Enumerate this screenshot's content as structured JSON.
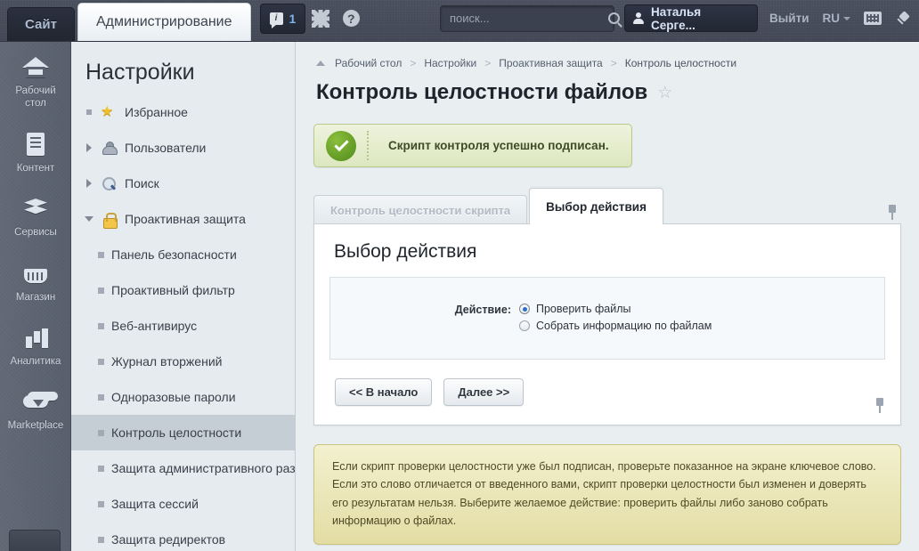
{
  "header": {
    "site_tab": "Сайт",
    "admin_tab": "Администрирование",
    "notifications_count": "1",
    "gear_icon": "gear-icon",
    "help_icon": "help-icon",
    "search_placeholder": "поиск...",
    "search_value": "",
    "user_name": "Наталья Серге...",
    "logout": "Выйти",
    "language": "RU",
    "keyboard_icon": "keyboard-icon",
    "pin_icon": "pin-icon"
  },
  "rail": {
    "items": [
      {
        "label": "Рабочий стол",
        "icon": "home-icon"
      },
      {
        "label": "Контент",
        "icon": "document-icon"
      },
      {
        "label": "Сервисы",
        "icon": "layers-icon"
      },
      {
        "label": "Магазин",
        "icon": "basket-icon"
      },
      {
        "label": "Аналитика",
        "icon": "bar-chart-icon"
      },
      {
        "label": "Marketplace",
        "icon": "cloud-download-icon"
      }
    ]
  },
  "nav": {
    "title": "Настройки",
    "items": [
      {
        "label": "Избранное",
        "twisty": "square",
        "icon": "star-icon",
        "selected": false,
        "sub": false
      },
      {
        "label": "Пользователи",
        "twisty": "right",
        "icon": "user-icon",
        "selected": false,
        "sub": false
      },
      {
        "label": "Поиск",
        "twisty": "right",
        "icon": "search-icon",
        "selected": false,
        "sub": false
      },
      {
        "label": "Проактивная защита",
        "twisty": "down",
        "icon": "lock-icon",
        "selected": false,
        "sub": false
      },
      {
        "label": "Панель безопасности",
        "twisty": "dot",
        "icon": "",
        "selected": false,
        "sub": true
      },
      {
        "label": "Проактивный фильтр",
        "twisty": "dot",
        "icon": "",
        "selected": false,
        "sub": true
      },
      {
        "label": "Веб-антивирус",
        "twisty": "dot",
        "icon": "",
        "selected": false,
        "sub": true
      },
      {
        "label": "Журнал вторжений",
        "twisty": "dot",
        "icon": "",
        "selected": false,
        "sub": true
      },
      {
        "label": "Одноразовые пароли",
        "twisty": "dot",
        "icon": "",
        "selected": false,
        "sub": true
      },
      {
        "label": "Контроль целостности",
        "twisty": "dot",
        "icon": "",
        "selected": true,
        "sub": true
      },
      {
        "label": "Защита административного раздела",
        "twisty": "dot",
        "icon": "",
        "selected": false,
        "sub": true
      },
      {
        "label": "Защита сессий",
        "twisty": "dot",
        "icon": "",
        "selected": false,
        "sub": true
      },
      {
        "label": "Защита редиректов",
        "twisty": "dot",
        "icon": "",
        "selected": false,
        "sub": true
      }
    ]
  },
  "main": {
    "breadcrumb": [
      "Рабочий стол",
      "Настройки",
      "Проактивная защита",
      "Контроль целостности"
    ],
    "breadcrumb_separator": ">",
    "page_title": "Контроль целостности файлов",
    "favorite_icon": "star-outline-icon",
    "success_message": "Скрипт контроля успешно подписан.",
    "success_icon": "check-circle-icon",
    "tabs": [
      {
        "label": "Контроль целостности скрипта",
        "state": "disabled"
      },
      {
        "label": "Выбор действия",
        "state": "active"
      }
    ],
    "panel_title": "Выбор действия",
    "form": {
      "field_label": "Действие:",
      "options": [
        {
          "label": "Проверить файлы",
          "selected": true
        },
        {
          "label": "Собрать информацию по файлам",
          "selected": false
        }
      ]
    },
    "buttons": {
      "back": "<< В начало",
      "next": "Далее >>"
    },
    "note": "Если скрипт проверки целостности уже был подписан, проверьте показанное на экране ключевое слово. Если это слово отличается от введенного вами, скрипт проверки целостности был изменен и доверять его результатам нельзя.\nВыберите желаемое действие: проверить файлы либо заново собрать информацию о файлах."
  },
  "colors": {
    "topbar": "#454c5a",
    "rail": "#5b6270",
    "nav_bg": "#e5ebee",
    "nav_selected": "#c6ced5",
    "content_bg": "#e9eef1",
    "success_border": "#b9c98c",
    "success_green": "#4e8a1b",
    "note_bg": "#e3dda4",
    "radio_accent": "#2a6fc9"
  }
}
